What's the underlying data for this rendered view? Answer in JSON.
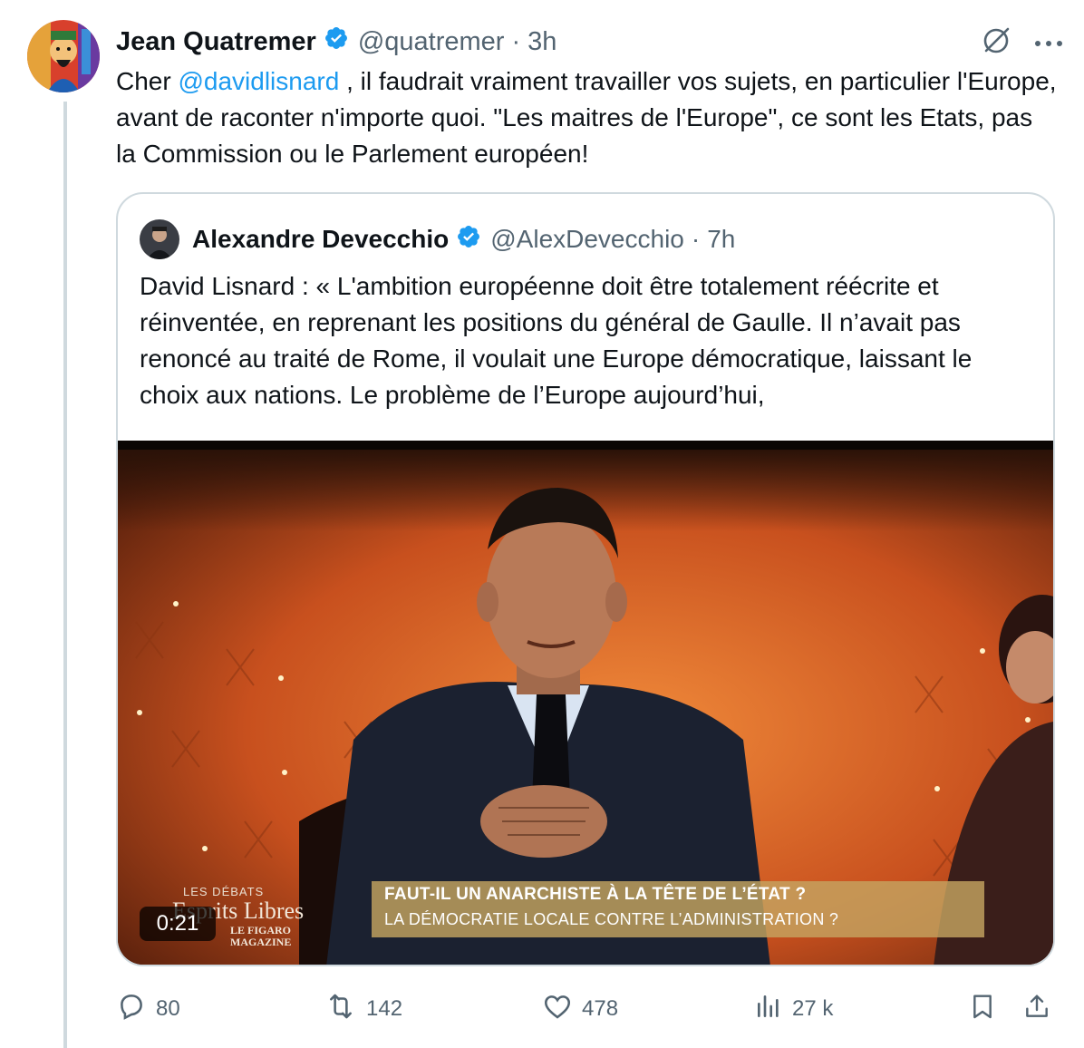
{
  "tweet": {
    "author_name": "Jean Quatremer",
    "handle": "@quatremer",
    "separator": "·",
    "time": "3h",
    "text_before_mention": "Cher ",
    "mention": "@davidlisnard",
    "text_after_mention": " , il faudrait vraiment travailler vos sujets, en particulier l'Europe, avant de raconter n'importe quoi. \"Les maitres de l'Europe\", ce sont les Etats, pas la Commission ou le Parlement européen!"
  },
  "quote": {
    "author_name": "Alexandre Devecchio",
    "handle": "@AlexDevecchio",
    "separator": "·",
    "time": "7h",
    "text": "David Lisnard : « L'ambition européenne doit être totalement réécrite et réinventée, en reprenant les positions du général de Gaulle. Il n’avait pas renoncé au traité de Rome, il voulait une Europe démocratique, laissant le choix aux nations. Le problème de l’Europe aujourd’hui,"
  },
  "video": {
    "duration": "0:21",
    "banner_title": "FAUT-IL UN ANARCHISTE À LA TÊTE DE L’ÉTAT ?",
    "banner_subtitle": "LA DÉMOCRATIE LOCALE CONTRE L’ADMINISTRATION ?",
    "logo_line1": "LES DÉBATS",
    "logo_line2": "Esprits Libres",
    "logo_line3": "LE FIGARO",
    "logo_line4": "MAGAZINE"
  },
  "actions": {
    "replies": "80",
    "reposts": "142",
    "likes": "478",
    "views": "27 k"
  },
  "icons": {
    "verified": "verified-badge-icon",
    "grok": "grok-icon",
    "more": "more-icon",
    "reply": "reply-icon",
    "repost": "repost-icon",
    "like": "like-icon",
    "views": "views-icon",
    "bookmark": "bookmark-icon",
    "share": "share-icon"
  },
  "colors": {
    "accent": "#1d9bf0",
    "muted": "#536471",
    "text": "#0f1419",
    "border": "#cfd9de"
  }
}
